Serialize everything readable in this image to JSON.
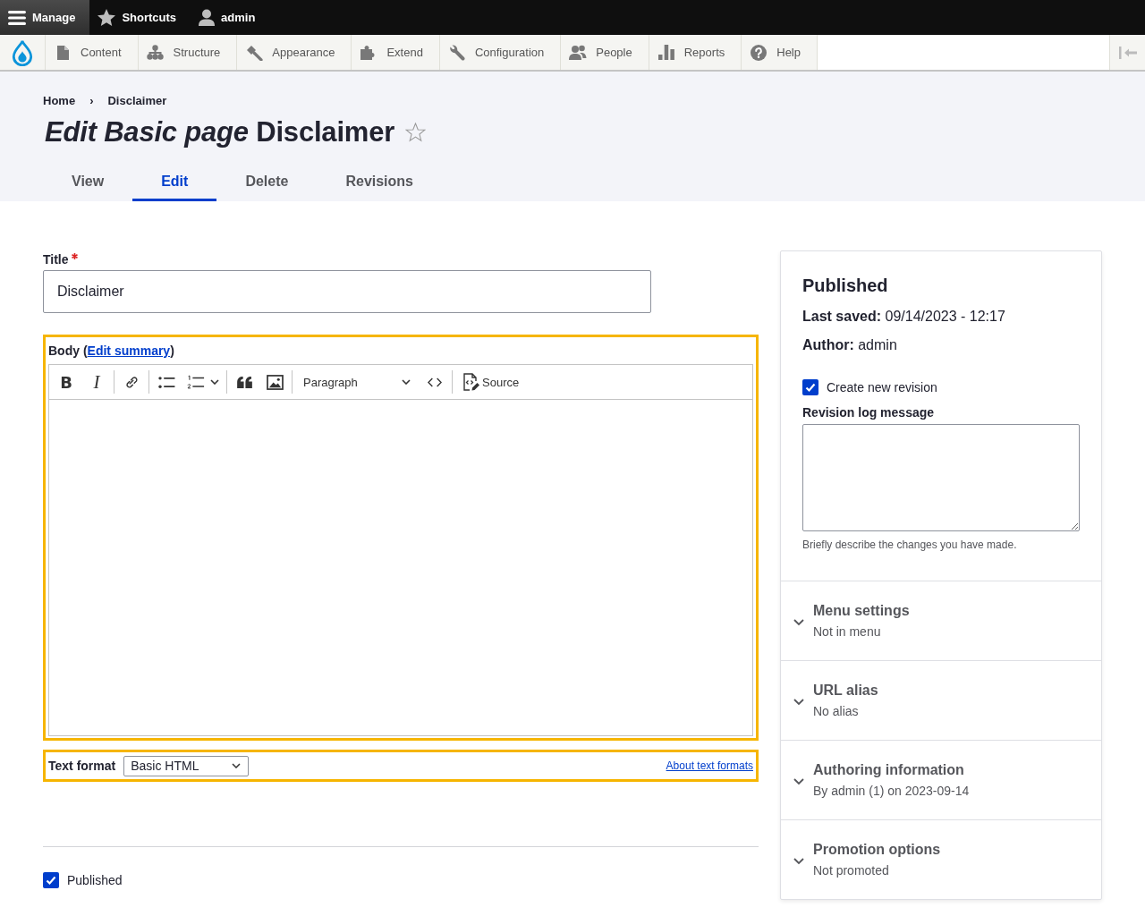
{
  "toolbar": {
    "items": [
      {
        "label": "Manage",
        "selected": true
      },
      {
        "label": "Shortcuts",
        "selected": false
      },
      {
        "label": "admin",
        "selected": false
      }
    ]
  },
  "tray": [
    "Content",
    "Structure",
    "Appearance",
    "Extend",
    "Configuration",
    "People",
    "Reports",
    "Help"
  ],
  "header": {
    "breadcrumb": [
      "Home",
      "Disclaimer"
    ],
    "breadcrumb_separator": "›",
    "title": "*Edit Basic page* Disclaimer",
    "starred": false
  },
  "tabs": [
    {
      "label": "View",
      "selected": false
    },
    {
      "label": "Edit",
      "selected": true
    },
    {
      "label": "Delete",
      "selected": false
    },
    {
      "label": "Revisions",
      "selected": false
    }
  ],
  "form": {
    "title_field": {
      "label": "Title",
      "required": true,
      "value": "Disclaimer"
    },
    "body": {
      "highlighted": true,
      "label_start": "Body (",
      "link": "Edit summary",
      "label_end": ")",
      "toolbar": [
        {
          "kind": "bold",
          "glyph": "B"
        },
        {
          "kind": "italic",
          "glyph": "I"
        },
        {
          "kind": "separator"
        },
        {
          "kind": "link"
        },
        {
          "kind": "separator"
        },
        {
          "kind": "bulleted-list"
        },
        {
          "kind": "numbered-list"
        },
        {
          "kind": "separator"
        },
        {
          "kind": "blockquote"
        },
        {
          "kind": "image"
        },
        {
          "kind": "separator"
        },
        {
          "kind": "heading",
          "label": "Paragraph"
        },
        {
          "kind": "code"
        },
        {
          "kind": "separator"
        },
        {
          "kind": "source",
          "label": "Source"
        }
      ]
    },
    "text_format": {
      "highlighted": true,
      "label": "Text format",
      "value": "Basic HTML",
      "link": "About text formats"
    },
    "published": {
      "label": "Published",
      "checked": true
    }
  },
  "sidebar": {
    "title": "Published",
    "meta": [
      "**Last saved:** 09/14/2023 - 12:17",
      "**Author:** admin"
    ],
    "revision": {
      "label": "Create new revision",
      "checked": true
    },
    "log": {
      "label": "Revision log message",
      "description": "Briefly describe the changes you have made."
    },
    "sections": [
      {
        "title": "Menu settings",
        "summary": "Not in menu",
        "expanded": false
      },
      {
        "title": "URL alias",
        "summary": "No alias",
        "expanded": false
      },
      {
        "title": "Authoring information",
        "summary": "By admin (1) on 2023-09-14",
        "expanded": false
      },
      {
        "title": "Promotion options",
        "summary": "Not promoted",
        "expanded": false
      }
    ]
  }
}
